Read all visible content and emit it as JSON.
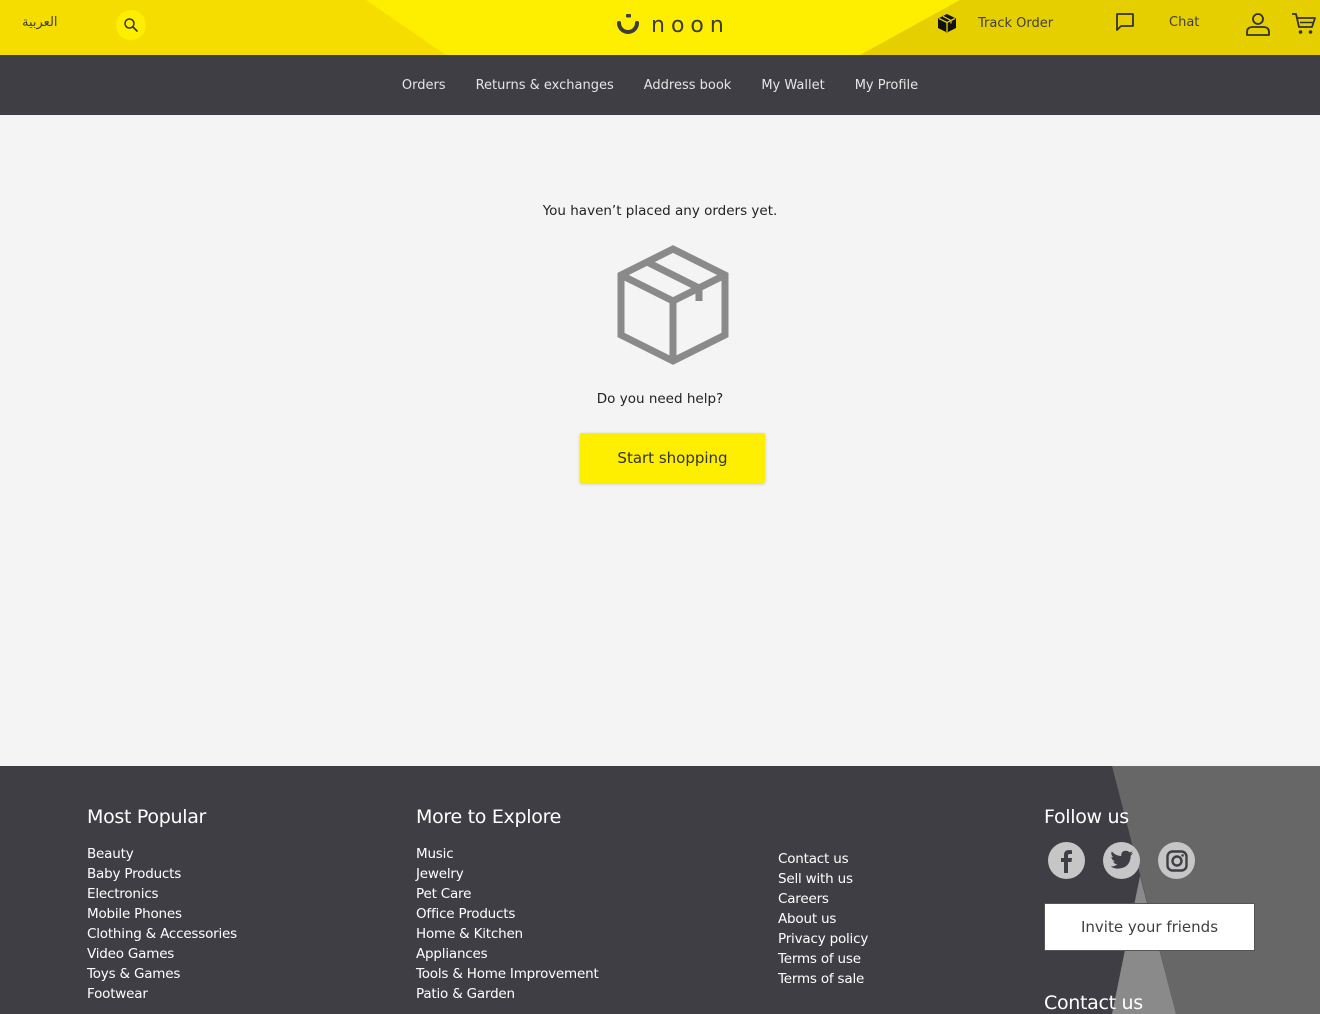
{
  "header": {
    "language_label": "العربية",
    "logo_text": "noon",
    "track_order_label": "Track Order",
    "chat_label": "Chat",
    "icons": {
      "search": "search-icon",
      "track": "box-icon",
      "chat": "chat-bubble-icon",
      "user": "user-icon",
      "cart": "cart-icon"
    },
    "colors": {
      "brand_yellow": "#feee00",
      "nav_bg": "#3f3e44"
    }
  },
  "nav": {
    "items": [
      {
        "label": "Orders"
      },
      {
        "label": "Returns & exchanges"
      },
      {
        "label": "Address book"
      },
      {
        "label": "My Wallet"
      },
      {
        "label": "My Profile"
      }
    ]
  },
  "main": {
    "empty_message": "You haven’t placed any orders yet.",
    "help_text": "Do you need help?",
    "start_button": "Start shopping"
  },
  "footer": {
    "most_popular": {
      "title": "Most Popular",
      "items": [
        "Beauty",
        "Baby Products",
        "Electronics",
        "Mobile Phones",
        "Clothing & Accessories",
        "Video Games",
        "Toys & Games",
        "Footwear"
      ]
    },
    "more_to_explore": {
      "title": "More to Explore",
      "items": [
        "Music",
        "Jewelry",
        "Pet Care",
        "Office Products",
        "Home & Kitchen",
        "Appliances",
        "Tools & Home Improvement",
        "Patio & Garden"
      ]
    },
    "links": {
      "items": [
        "Contact us",
        "Sell with us",
        "Careers",
        "About us",
        "Privacy policy",
        "Terms of use",
        "Terms of sale"
      ]
    },
    "follow": {
      "title": "Follow us",
      "socials": [
        "facebook-icon",
        "twitter-icon",
        "instagram-icon"
      ]
    },
    "invite_button": "Invite your friends",
    "contact_title": "Contact us"
  }
}
